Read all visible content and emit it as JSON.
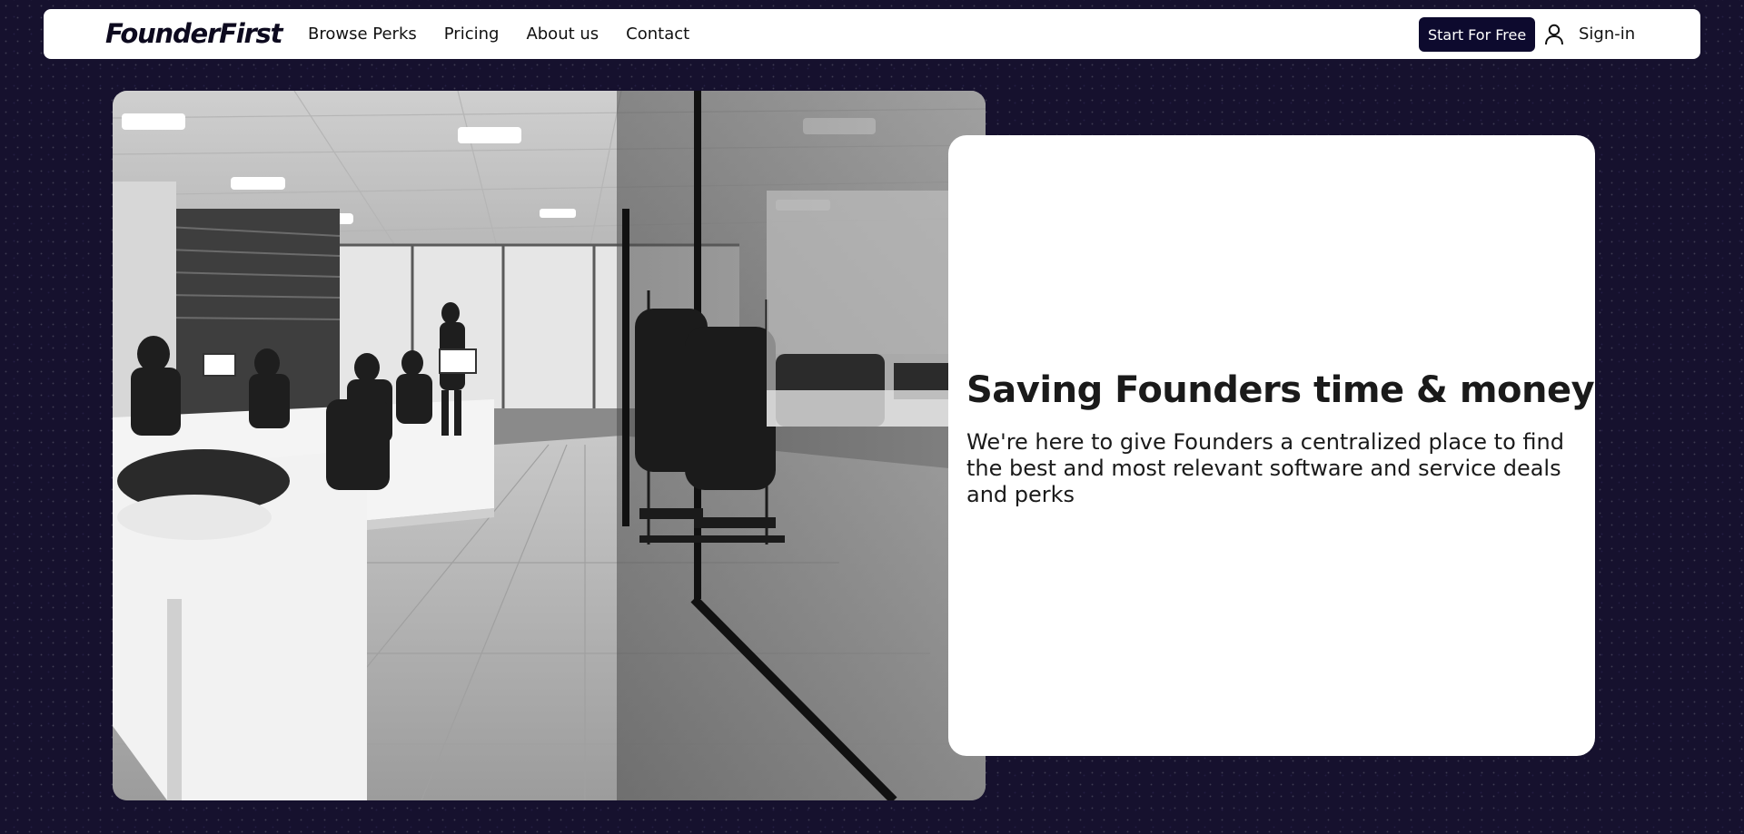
{
  "brand": {
    "logo_text": "FounderFirst"
  },
  "nav": {
    "links": [
      {
        "label": "Browse Perks"
      },
      {
        "label": "Pricing"
      },
      {
        "label": "About us"
      },
      {
        "label": "Contact"
      }
    ],
    "cta_label": "Start For Free",
    "signin_label": "Sign-in",
    "signin_icon": "user-icon"
  },
  "hero": {
    "title": "Saving Founders time & money",
    "subtitle": "We're here to give Founders a centralized place to find the best and most relevant software and service deals and perks",
    "image_subject": "office-photo"
  },
  "colors": {
    "page_background": "#16112e",
    "cta_background": "#0d0a2e",
    "card_background": "#ffffff"
  }
}
